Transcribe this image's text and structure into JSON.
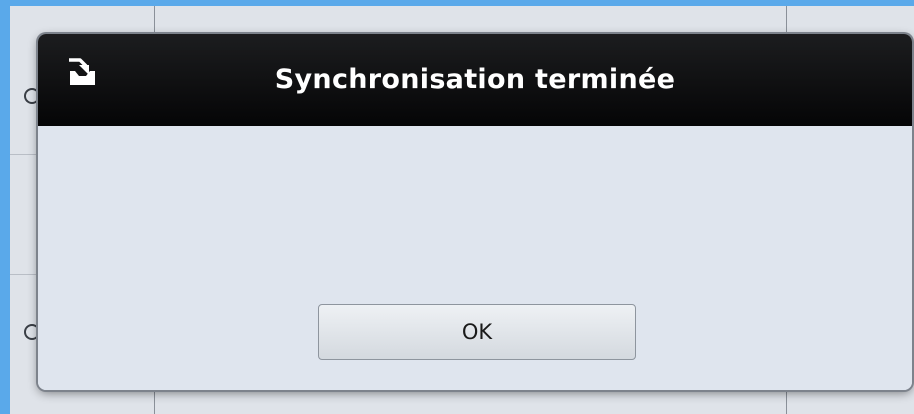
{
  "dialog": {
    "icon": "sync-download-icon",
    "title": "Synchronisation terminée",
    "ok_label": "OK"
  },
  "colors": {
    "frame": "#5aa9ea",
    "titlebar": "#0e0f10",
    "dialog_body": "#dfe5ee"
  }
}
